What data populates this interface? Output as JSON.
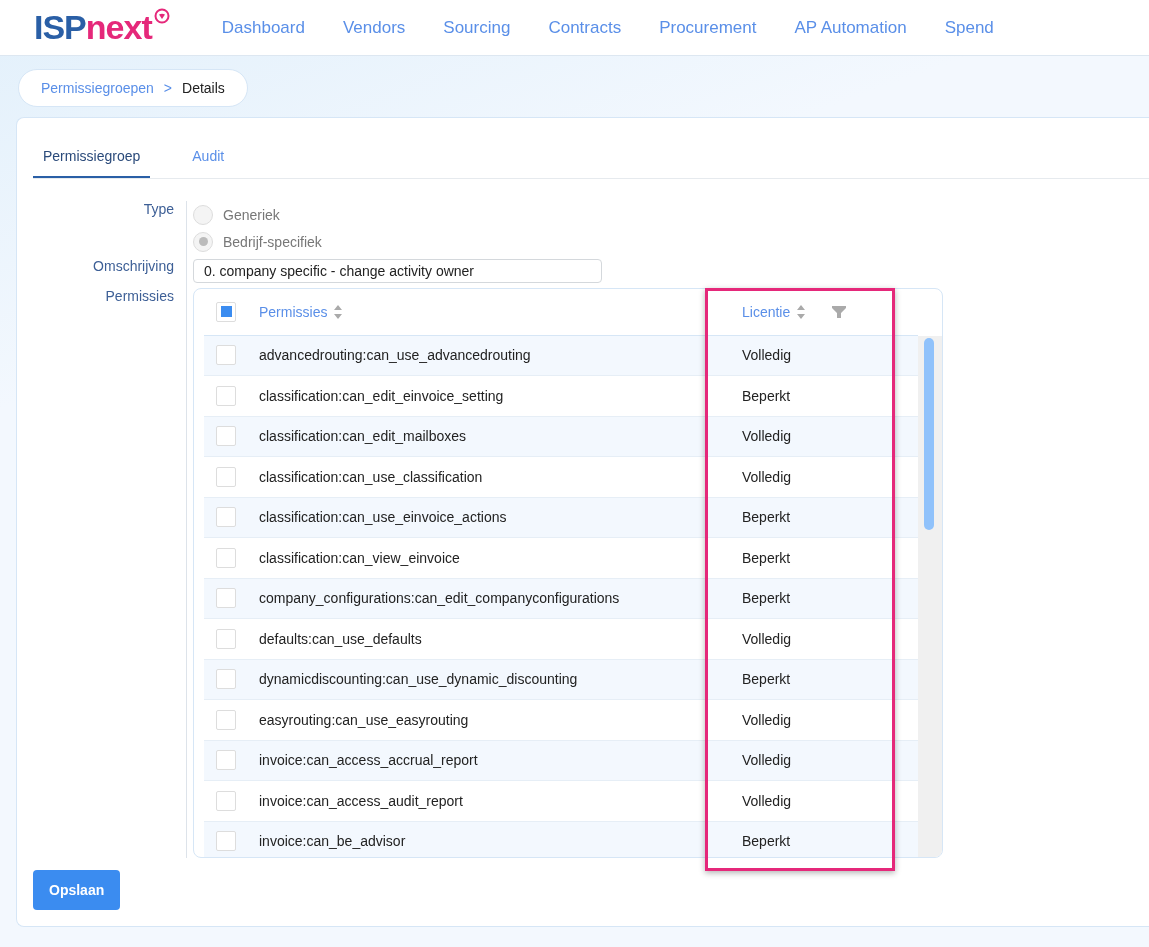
{
  "logo": {
    "part_1": "ISP",
    "part_2": "next"
  },
  "nav": [
    "Dashboard",
    "Vendors",
    "Sourcing",
    "Contracts",
    "Procurement",
    "AP Automation",
    "Spend"
  ],
  "breadcrumb": {
    "parent": "Permissiegroepen",
    "separator": ">",
    "current": "Details"
  },
  "tabs": [
    {
      "label": "Permissiegroep",
      "selected": true
    },
    {
      "label": "Audit",
      "selected": false
    }
  ],
  "form": {
    "type_label": "Type",
    "type_options": [
      {
        "label": "Generiek",
        "selected": false
      },
      {
        "label": "Bedrijf-specifiek",
        "selected": true
      }
    ],
    "description_label": "Omschrijving",
    "description_value": "0. company specific - change activity owner",
    "permissions_label": "Permissies"
  },
  "table": {
    "header_checked": true,
    "columns": [
      "Permissies",
      "Licentie"
    ],
    "rows": [
      {
        "permission": "advancedrouting:can_use_advancedrouting",
        "license": "Volledig",
        "checked": false
      },
      {
        "permission": "classification:can_edit_einvoice_setting",
        "license": "Beperkt",
        "checked": false
      },
      {
        "permission": "classification:can_edit_mailboxes",
        "license": "Volledig",
        "checked": false
      },
      {
        "permission": "classification:can_use_classification",
        "license": "Volledig",
        "checked": false
      },
      {
        "permission": "classification:can_use_einvoice_actions",
        "license": "Beperkt",
        "checked": false
      },
      {
        "permission": "classification:can_view_einvoice",
        "license": "Beperkt",
        "checked": false
      },
      {
        "permission": "company_configurations:can_edit_companyconfigurations",
        "license": "Beperkt",
        "checked": false
      },
      {
        "permission": "defaults:can_use_defaults",
        "license": "Volledig",
        "checked": false
      },
      {
        "permission": "dynamicdiscounting:can_use_dynamic_discounting",
        "license": "Beperkt",
        "checked": false
      },
      {
        "permission": "easyrouting:can_use_easyrouting",
        "license": "Volledig",
        "checked": false
      },
      {
        "permission": "invoice:can_access_accrual_report",
        "license": "Volledig",
        "checked": false
      },
      {
        "permission": "invoice:can_access_audit_report",
        "license": "Volledig",
        "checked": false
      },
      {
        "permission": "invoice:can_be_advisor",
        "license": "Beperkt",
        "checked": false
      }
    ]
  },
  "save_button": "Opslaan"
}
